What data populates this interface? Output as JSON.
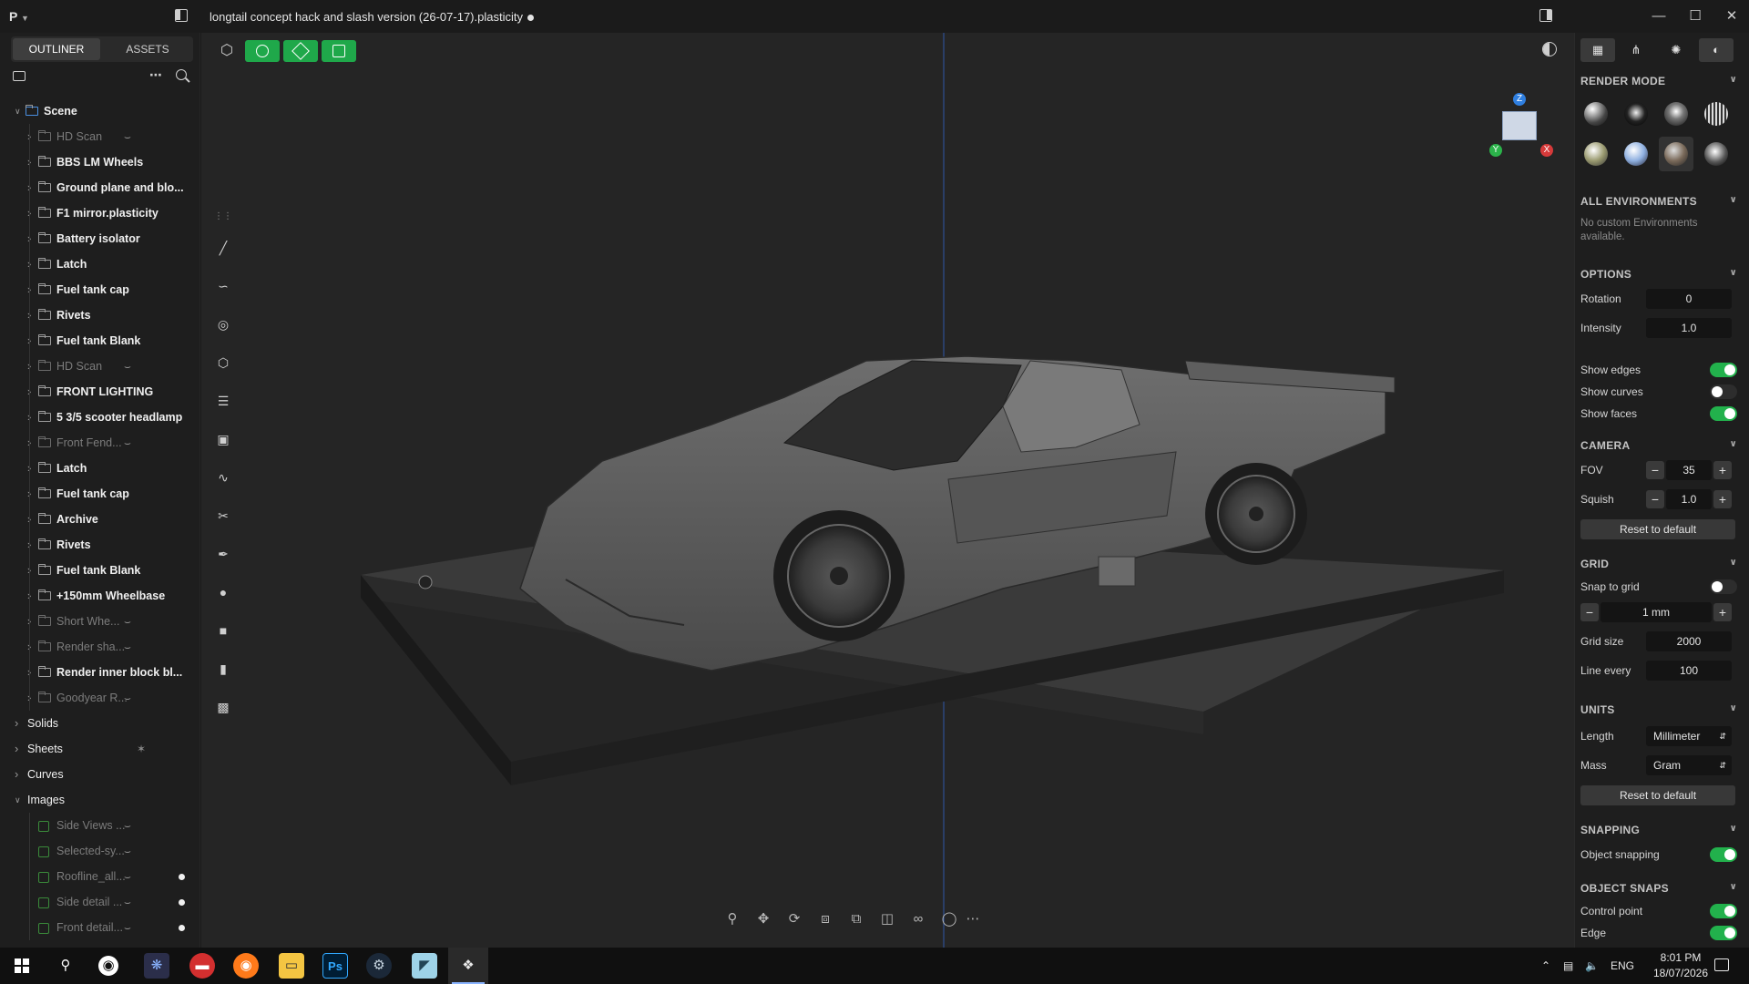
{
  "window": {
    "app_menu": "P",
    "title": "longtail concept hack and slash version (26-07-17).plasticity"
  },
  "outliner": {
    "tab_outliner": "OUTLINER",
    "tab_assets": "ASSETS",
    "items": [
      {
        "label": "Scene",
        "dim": false,
        "indent": 0
      },
      {
        "label": "HD Scan",
        "dim": true,
        "indent": 1
      },
      {
        "label": "BBS LM Wheels",
        "dim": false,
        "indent": 1
      },
      {
        "label": "Ground plane and blo...",
        "dim": false,
        "indent": 1
      },
      {
        "label": "F1 mirror.plasticity",
        "dim": false,
        "indent": 1
      },
      {
        "label": "Battery isolator",
        "dim": false,
        "indent": 1
      },
      {
        "label": "Latch",
        "dim": false,
        "indent": 1
      },
      {
        "label": "Fuel tank cap",
        "dim": false,
        "indent": 1
      },
      {
        "label": "Rivets",
        "dim": false,
        "indent": 1
      },
      {
        "label": "Fuel tank Blank",
        "dim": false,
        "indent": 1
      },
      {
        "label": "HD Scan",
        "dim": true,
        "indent": 1
      },
      {
        "label": "FRONT LIGHTING",
        "dim": false,
        "indent": 1
      },
      {
        "label": "5 3/5 scooter headlamp",
        "dim": false,
        "indent": 1
      },
      {
        "label": "Front Fend...",
        "dim": true,
        "indent": 1
      },
      {
        "label": "Latch",
        "dim": false,
        "indent": 1
      },
      {
        "label": "Fuel tank cap",
        "dim": false,
        "indent": 1
      },
      {
        "label": "Archive",
        "dim": false,
        "indent": 1
      },
      {
        "label": "Rivets",
        "dim": false,
        "indent": 1
      },
      {
        "label": "Fuel tank Blank",
        "dim": false,
        "indent": 1
      },
      {
        "label": "+150mm Wheelbase",
        "dim": false,
        "indent": 1
      },
      {
        "label": "Short Whe...",
        "dim": true,
        "indent": 1
      },
      {
        "label": "Render sha...",
        "dim": true,
        "indent": 1
      },
      {
        "label": "Render inner block bl...",
        "dim": false,
        "indent": 1
      },
      {
        "label": "Goodyear R...",
        "dim": true,
        "indent": 1
      }
    ],
    "groups": [
      {
        "label": "Solids"
      },
      {
        "label": "Sheets"
      },
      {
        "label": "Curves"
      },
      {
        "label": "Images"
      }
    ],
    "images": [
      {
        "label": "Side Views ...",
        "dot": false
      },
      {
        "label": "Selected-sy...",
        "dot": false
      },
      {
        "label": "Roofline_all...",
        "dot": true
      },
      {
        "label": "Side detail ...",
        "dot": true
      },
      {
        "label": "Front detail...",
        "dot": true
      }
    ]
  },
  "right_panel": {
    "render_mode": {
      "title": "RENDER MODE"
    },
    "environments": {
      "title": "ALL ENVIRONMENTS",
      "empty_text": "No custom Environments available."
    },
    "options": {
      "title": "OPTIONS",
      "rotation_label": "Rotation",
      "rotation_value": "0",
      "intensity_label": "Intensity",
      "intensity_value": "1.0",
      "show_edges": "Show edges",
      "show_curves": "Show curves",
      "show_faces": "Show faces",
      "show_edges_on": true,
      "show_curves_on": false,
      "show_faces_on": true
    },
    "camera": {
      "title": "CAMERA",
      "fov_label": "FOV",
      "fov_value": "35",
      "squish_label": "Squish",
      "squish_value": "1.0",
      "reset": "Reset to default"
    },
    "grid": {
      "title": "GRID",
      "snap_label": "Snap to grid",
      "snap_on": false,
      "step_value": "1 mm",
      "size_label": "Grid size",
      "size_value": "2000",
      "line_every_label": "Line every",
      "line_every_value": "100"
    },
    "units": {
      "title": "UNITS",
      "length_label": "Length",
      "length_value": "Millimeter",
      "mass_label": "Mass",
      "mass_value": "Gram",
      "reset": "Reset to default"
    },
    "snapping": {
      "title": "SNAPPING",
      "object_snapping": "Object snapping",
      "object_snapping_on": true
    },
    "object_snaps": {
      "title": "OBJECT SNAPS",
      "control_point": "Control point",
      "edge": "Edge",
      "control_point_on": true,
      "edge_on": true
    }
  },
  "viewcube": {
    "z": "Z",
    "y": "Y",
    "x": "X"
  },
  "taskbar": {
    "lang": "ENG",
    "time": "8:01 PM",
    "date": "18/07/2026",
    "ps_label": "Ps"
  },
  "colors": {
    "accent_green": "#1fa84a",
    "toggle_green": "#22b14c"
  }
}
